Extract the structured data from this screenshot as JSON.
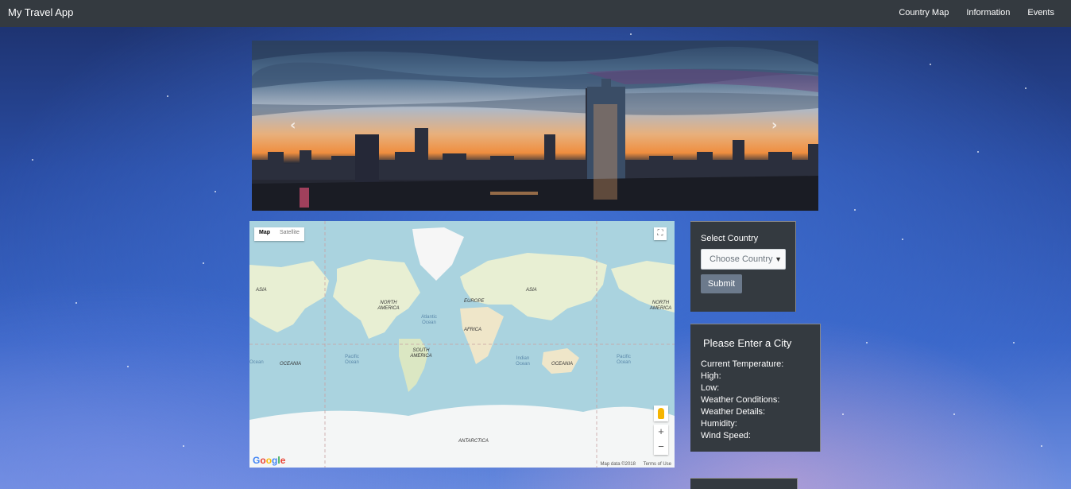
{
  "navbar": {
    "brand": "My Travel App",
    "links": [
      "Country Map",
      "Information",
      "Events"
    ]
  },
  "carousel": {
    "prev_icon": "chevron-left-icon",
    "next_icon": "chevron-right-icon"
  },
  "map": {
    "type_controls": [
      "Map",
      "Satellite"
    ],
    "active_type": "Map",
    "continent_labels": [
      "ASIA",
      "NORTH AMERICA",
      "EUROPE",
      "ASIA",
      "NORTH AMERICA",
      "AFRICA",
      "SOUTH AMERICA",
      "OCEANIA",
      "OCEANIA",
      "ANTARCTICA"
    ],
    "ocean_labels": [
      "Atlantic Ocean",
      "Pacific Ocean",
      "Indian Ocean",
      "Pacific Ocean",
      "Ocean"
    ],
    "zoom_in": "+",
    "zoom_out": "−",
    "logo": "Google",
    "attribution": "Map data ©2018",
    "terms": "Terms of Use",
    "fullscreen_icon": "fullscreen-icon",
    "pegman_icon": "street-view-pegman-icon"
  },
  "country_panel": {
    "label": "Select Country",
    "select_value": "Choose Country",
    "submit": "Submit"
  },
  "weather_panel": {
    "title": "Please Enter a City",
    "fields": [
      "Current Temperature:",
      "High:",
      "Low:",
      "Weather Conditions:",
      "Weather Details:",
      "Humidity:",
      "Wind Speed:"
    ]
  },
  "colors": {
    "navbar": "#343a40",
    "panel": "#343a40",
    "button": "#6c7a8c",
    "water": "#aad3df",
    "land": "#e8efd3"
  }
}
